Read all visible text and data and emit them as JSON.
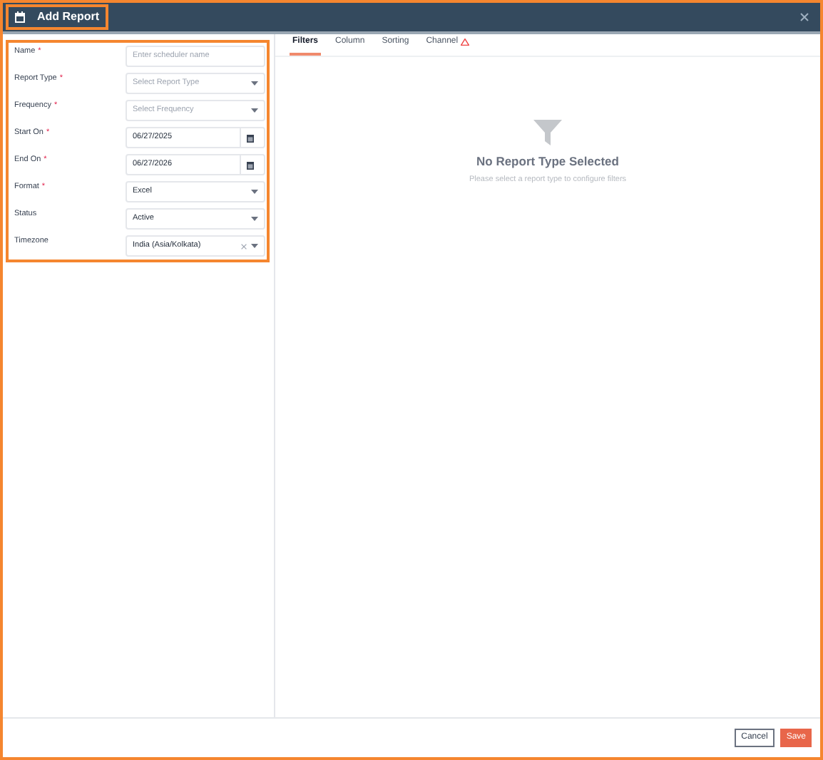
{
  "window": {
    "title": "Add Report"
  },
  "form": [
    {
      "label": "Name",
      "required_mark": "*",
      "kind": "text",
      "placeholder": "Enter scheduler name"
    },
    {
      "label": "Report Type",
      "required_mark": "*",
      "kind": "select",
      "placeholder": "Select Report Type"
    },
    {
      "label": "Frequency",
      "required_mark": "*",
      "kind": "select",
      "placeholder": "Select Frequency"
    },
    {
      "label": "Start On",
      "required_mark": "*",
      "kind": "date",
      "value": "06/27/2025"
    },
    {
      "label": "End On",
      "required_mark": "*",
      "kind": "date",
      "value": "06/27/2026"
    },
    {
      "label": "Format",
      "required_mark": "*",
      "kind": "select",
      "value": "Excel"
    },
    {
      "label": "Status",
      "kind": "select",
      "value": "Active"
    },
    {
      "label": "Timezone",
      "kind": "clearable",
      "value": "India (Asia/Kolkata)"
    }
  ],
  "tabs": [
    {
      "label": "Filters",
      "selected": true,
      "warning": false
    },
    {
      "label": "Column",
      "selected": false,
      "warning": false
    },
    {
      "label": "Sorting",
      "selected": false,
      "warning": false
    },
    {
      "label": "Channel",
      "selected": false,
      "warning": true
    }
  ],
  "empty_state": {
    "title": "No Report Type Selected",
    "message": "Please select a report type to configure filters"
  },
  "buttons": [
    {
      "label": "Cancel",
      "kind": "secondary"
    },
    {
      "label": "Save",
      "kind": "primary"
    }
  ]
}
